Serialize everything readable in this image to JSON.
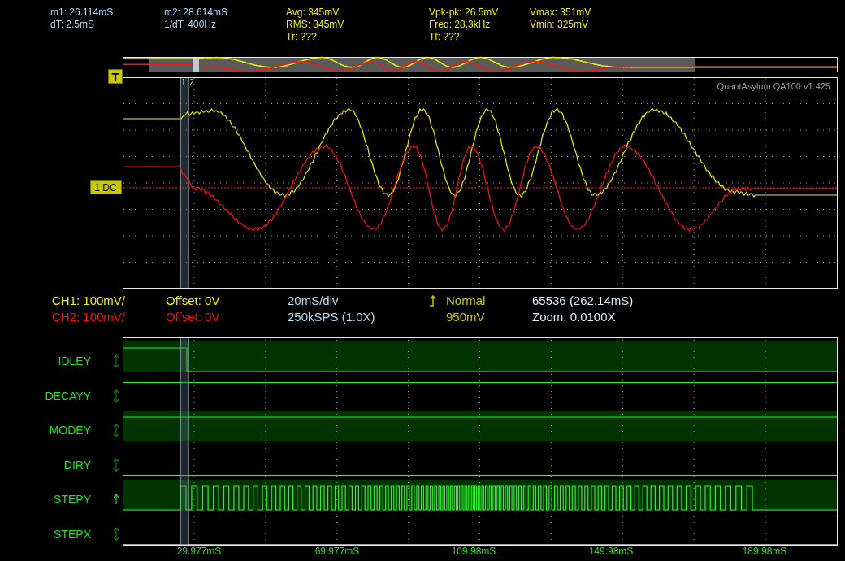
{
  "measurements": [
    {
      "kind": "cursor",
      "lines": [
        "m1: 26.114mS",
        "dT: 2.5mS"
      ]
    },
    {
      "kind": "cursor",
      "lines": [
        "m2: 28.614mS",
        "1/dT: 400Hz"
      ]
    },
    {
      "kind": "stat",
      "lines": [
        "Avg: 345mV",
        "RMS: 345mV",
        "Tr: ???"
      ]
    },
    {
      "kind": "stat",
      "lines": [
        "Vpk-pk: 26.5mV",
        "Freq: 28.3kHz",
        "Tf: ???"
      ]
    },
    {
      "kind": "stat",
      "lines": [
        "Vmax: 351mV",
        "Vmin: 325mV"
      ]
    }
  ],
  "scope": {
    "trigger_marker": "T",
    "channel_marker": "1 DC",
    "cursor_labels": [
      "1",
      "2"
    ],
    "instrument_label": "QuantAsylum QA100 v1.425"
  },
  "settings": [
    {
      "lines": [
        {
          "text": "CH1: 100mV/",
          "kind": "ch1"
        },
        {
          "text": "CH2: 100mV/",
          "kind": "ch2"
        }
      ]
    },
    {
      "lines": [
        {
          "text": "Offset: 0V",
          "kind": "ch1"
        },
        {
          "text": "Offset: 0V",
          "kind": "ch2"
        }
      ]
    },
    {
      "lines": [
        {
          "text": "20mS/div",
          "kind": "time"
        },
        {
          "text": "250kSPS (1.0X)",
          "kind": "time"
        }
      ]
    },
    {
      "lines": [
        {
          "text": "Normal",
          "kind": "trigger-edge"
        },
        {
          "text": "950mV",
          "kind": "trigger"
        }
      ]
    },
    {
      "lines": [
        {
          "text": "65536 (262.14mS)",
          "kind": "info"
        },
        {
          "text": "Zoom: 0.0100X",
          "kind": "info"
        }
      ]
    }
  ],
  "logic_channels": [
    {
      "name": "IDLEY",
      "kind": "either"
    },
    {
      "name": "DECAYY",
      "kind": "either"
    },
    {
      "name": "MODEY",
      "kind": "either"
    },
    {
      "name": "DIRY",
      "kind": "either"
    },
    {
      "name": "STEPY",
      "kind": "rising"
    },
    {
      "name": "STEPX",
      "kind": "either"
    }
  ],
  "time_axis": [
    "29.977mS",
    "69.977mS",
    "109.98mS",
    "149.98mS",
    "189.98mS"
  ]
}
